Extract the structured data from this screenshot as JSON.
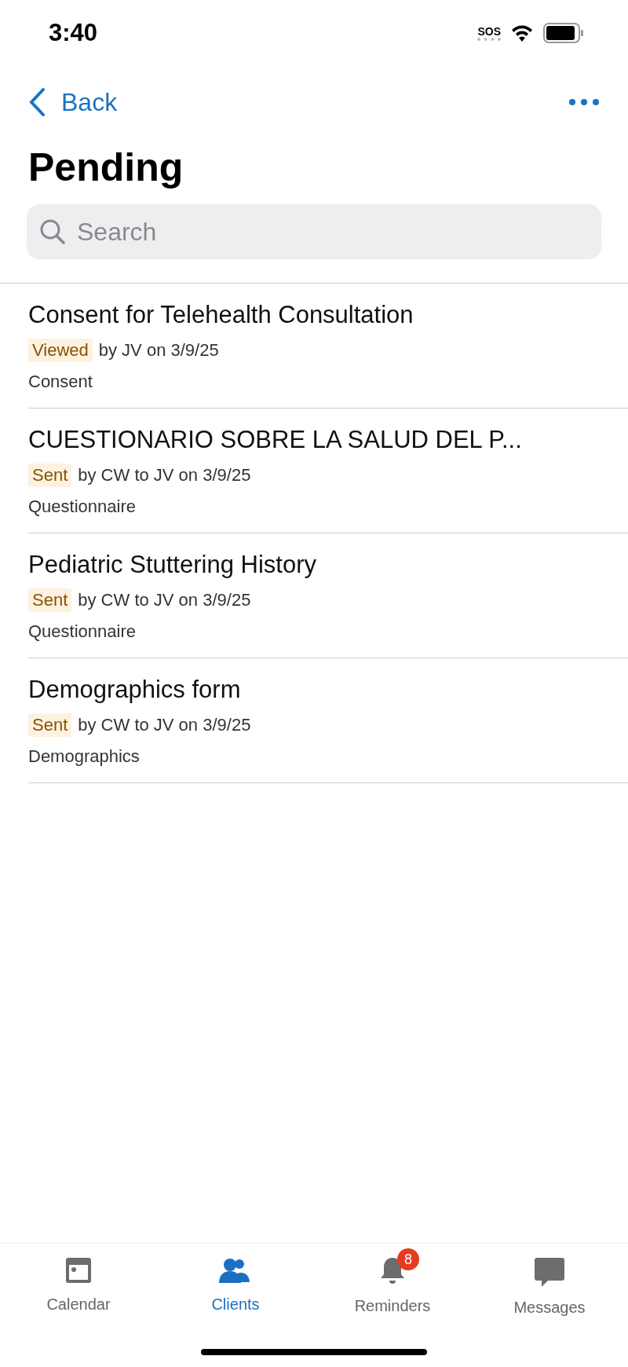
{
  "status_bar": {
    "time": "3:40",
    "sos": "SOS"
  },
  "nav": {
    "back": "Back"
  },
  "title": "Pending",
  "search": {
    "placeholder": "Search"
  },
  "items": [
    {
      "title": "Consent for Telehealth Consultation",
      "status": "Viewed",
      "detail": "by JV on 3/9/25",
      "type": "Consent"
    },
    {
      "title": "CUESTIONARIO SOBRE LA SALUD DEL P...",
      "status": "Sent",
      "detail": "by CW to JV on 3/9/25",
      "type": "Questionnaire"
    },
    {
      "title": "Pediatric Stuttering History",
      "status": "Sent",
      "detail": "by CW to JV on 3/9/25",
      "type": "Questionnaire"
    },
    {
      "title": "Demographics form",
      "status": "Sent",
      "detail": "by CW to JV on 3/9/25",
      "type": "Demographics"
    }
  ],
  "tabs": [
    {
      "kind": "calendar",
      "label": "Calendar",
      "selected": false
    },
    {
      "kind": "clients",
      "label": "Clients",
      "selected": true
    },
    {
      "kind": "reminders",
      "label": "Reminders",
      "selected": false,
      "badge": "8"
    },
    {
      "kind": "messages",
      "label": "Messages",
      "selected": false
    }
  ]
}
